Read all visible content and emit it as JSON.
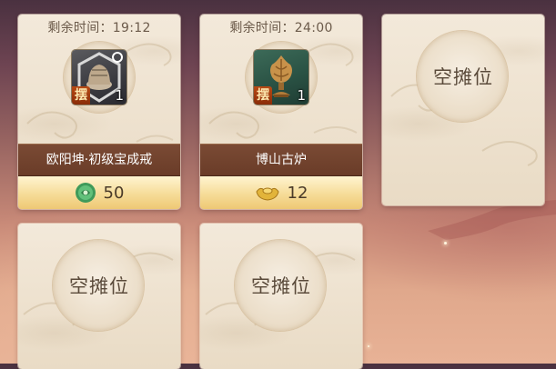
{
  "stalls": [
    {
      "state": "occupied",
      "timer_label": "剩余时间：19:12",
      "item_name": "欧阳坤·初级宝成戒",
      "item_icon": "hat-icon",
      "stall_tag": "摆",
      "quantity": "1",
      "currency_icon": "jade-coin-icon",
      "price": "50"
    },
    {
      "state": "occupied",
      "timer_label": "剩余时间：24:00",
      "item_name": "博山古炉",
      "item_icon": "incense-burner-icon",
      "stall_tag": "摆",
      "quantity": "1",
      "currency_icon": "gold-ingot-icon",
      "price": "12"
    },
    {
      "state": "empty",
      "label": "空摊位"
    },
    {
      "state": "empty",
      "label": "空摊位"
    },
    {
      "state": "empty",
      "label": "空摊位"
    }
  ],
  "colors": {
    "name_bar": "#6e4030",
    "price_bar": "#f6dc98",
    "stall_tag": "#a23c10",
    "card_bg": "#eee2cf"
  }
}
